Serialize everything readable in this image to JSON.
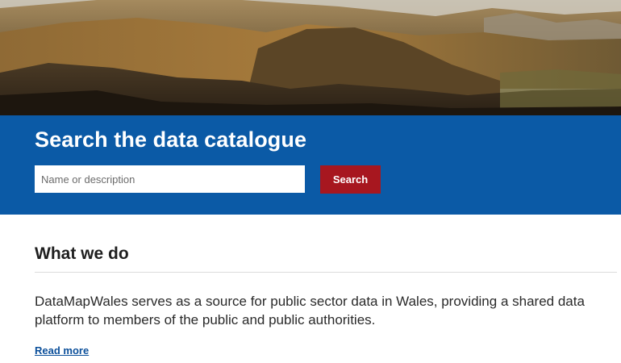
{
  "hero": {
    "image_icon": "mountain-landscape-photo"
  },
  "search": {
    "title": "Search the data catalogue",
    "placeholder": "Name or description",
    "value": "",
    "button_label": "Search"
  },
  "about": {
    "heading": "What we do",
    "text": "DataMapWales serves as a source for public sector data in Wales, providing a shared data platform to members of the public and public authorities.",
    "link_label": "Read more"
  },
  "colors": {
    "band": "#0b5aa6",
    "button": "#a7171f",
    "link": "#0b4f9a"
  }
}
